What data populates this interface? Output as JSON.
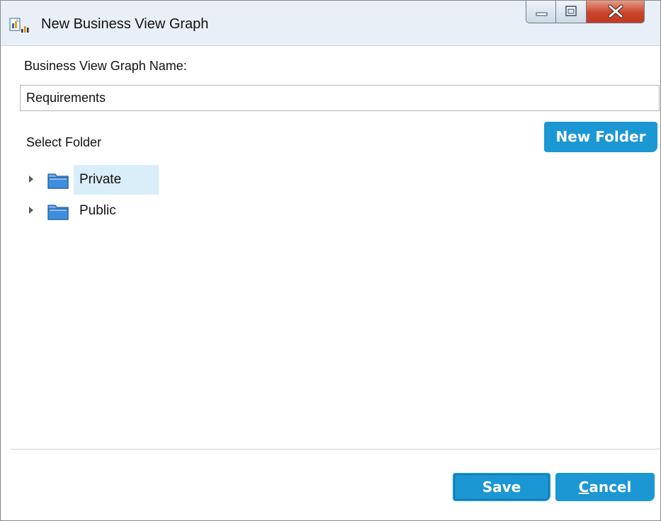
{
  "window": {
    "title": "New Business View Graph",
    "app_icon": "business-view-graph-icon",
    "controls": {
      "minimize_icon": "minimize-icon",
      "maximize_icon": "maximize-icon",
      "close_icon": "close-icon"
    }
  },
  "form": {
    "name_label": "Business View Graph Name:",
    "name_value": "Requirements",
    "folder_label": "Select Folder",
    "new_folder_label": "New Folder"
  },
  "tree": {
    "items": [
      {
        "label": "Private",
        "icon": "folder-icon",
        "selected": true
      },
      {
        "label": "Public",
        "icon": "folder-icon",
        "selected": false
      }
    ]
  },
  "footer": {
    "save_label": "Save",
    "cancel_mnemonic": "C",
    "cancel_rest": "ancel"
  },
  "colors": {
    "accent": "#1b97d4",
    "selection": "#d9eef9",
    "close_button": "#c9452c"
  }
}
